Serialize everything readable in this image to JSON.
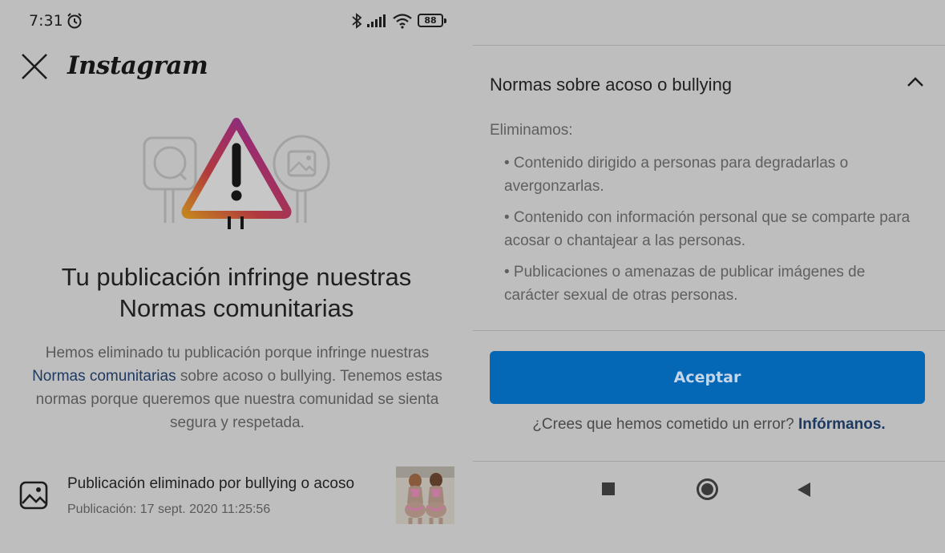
{
  "status_bar": {
    "time": "7:31",
    "battery": "88",
    "icons": [
      "alarm-icon",
      "bluetooth-icon",
      "signal-icon",
      "wifi-icon",
      "battery-icon"
    ]
  },
  "header": {
    "close_icon": "close-icon",
    "logo": "Instagram"
  },
  "notice": {
    "title": "Tu publicación infringe nuestras Normas comunitarias",
    "desc_part1": "Hemos eliminado tu publicación porque infringe nuestras ",
    "desc_link": "Normas comunitarias",
    "desc_part2": " sobre acoso o bullying. Tenemos estas normas porque queremos que nuestra comunidad se sienta segura y respetada."
  },
  "post": {
    "title": "Publicación eliminado por bullying o acoso",
    "date": "Publicación: 17 sept. 2020 11:25:56"
  },
  "policy": {
    "section_title": "Normas sobre acoso o bullying",
    "intro": "Eliminamos:",
    "bullets": [
      "• Contenido dirigido a personas para degradarlas o avergonzarlas.",
      "• Contenido con información personal que se comparte para acosar o chantajear a las personas.",
      "• Publicaciones o amenazas de publicar imágenes de carácter sexual de otras personas."
    ]
  },
  "actions": {
    "accept_label": "Aceptar",
    "error_question": "¿Crees que hemos cometido un error? ",
    "report_link": "Infórmanos."
  },
  "colors": {
    "accent_blue": "#0468b7",
    "link_blue": "#1e3a63",
    "background": "#bebebe"
  }
}
